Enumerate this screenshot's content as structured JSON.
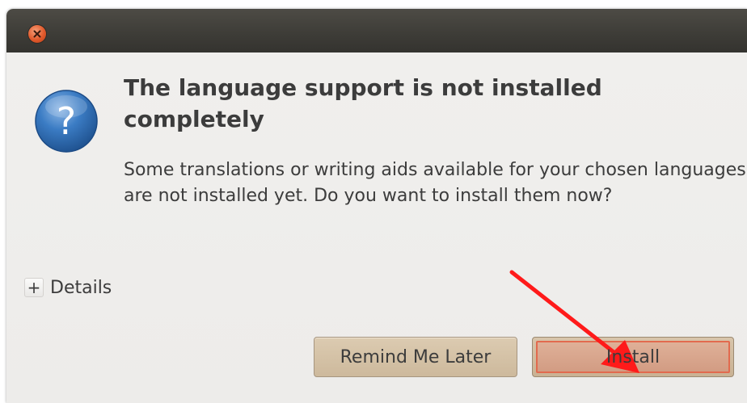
{
  "window": {
    "close_icon": "close-icon"
  },
  "dialog": {
    "icon": "question-icon",
    "title": "The language support is not installed completely",
    "message": "Some translations or writing aids available for your chosen languages are not installed yet. Do you want to install them now?",
    "details_toggle": "+",
    "details_label": "Details"
  },
  "buttons": {
    "remind_label": "Remind Me Later",
    "install_label": "Install"
  },
  "annotation": {
    "arrow_icon": "red-arrow-icon",
    "arrow_color": "#ff1a1a"
  },
  "colors": {
    "titlebar": "#3d3c37",
    "background": "#f2f1f0",
    "close_button": "#e1592b",
    "button_fill": "#d4c0a4",
    "install_focus_border": "#e26a4e",
    "question_icon": "#2f6fb5"
  }
}
